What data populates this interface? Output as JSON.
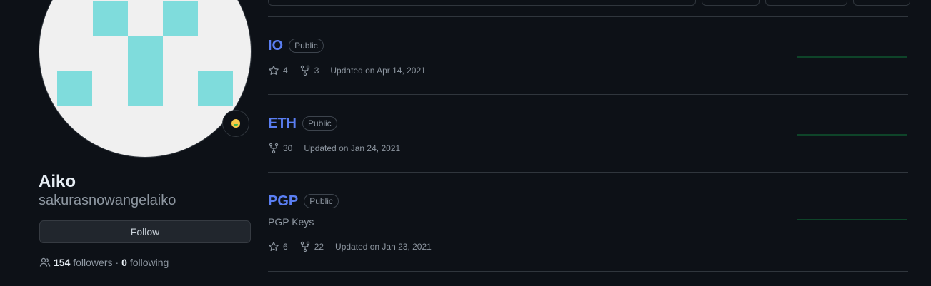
{
  "profile": {
    "display_name": "Aiko",
    "username": "sakurasnowangelaiko",
    "follow_label": "Follow",
    "followers_count": "154",
    "followers_label": "followers",
    "separator": "·",
    "following_count": "0",
    "following_label": "following",
    "status_icon": "money-mouth-face-icon",
    "avatar_colors": {
      "background": "#f0f0f0",
      "blocks": "#7fdcdc"
    }
  },
  "repos": [
    {
      "name": "IO",
      "visibility": "Public",
      "description": "",
      "stars": "4",
      "forks": "3",
      "updated": "Updated on Apr 14, 2021"
    },
    {
      "name": "ETH",
      "visibility": "Public",
      "description": "",
      "forks": "30",
      "updated": "Updated on Jan 24, 2021"
    },
    {
      "name": "PGP",
      "visibility": "Public",
      "description": "PGP Keys",
      "stars": "6",
      "forks": "22",
      "updated": "Updated on Jan 23, 2021"
    }
  ],
  "colors": {
    "background": "#0d1117",
    "link": "#5a7ef2",
    "muted": "#8d96a0",
    "border": "#30363d",
    "activity_line": "#0e4429"
  }
}
